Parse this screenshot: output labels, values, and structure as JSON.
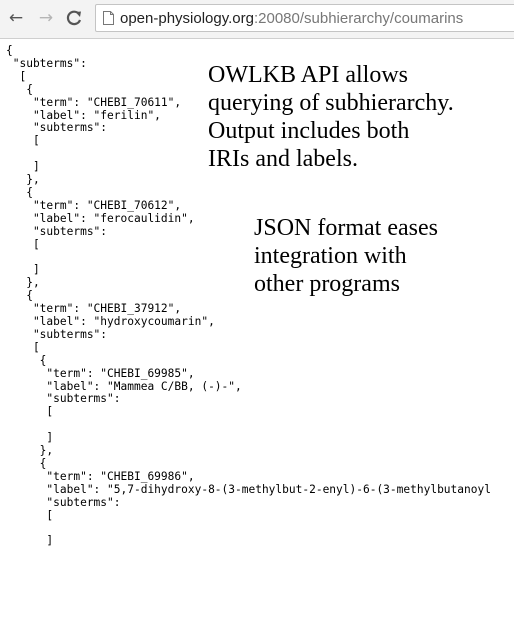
{
  "browser": {
    "back_icon": "←",
    "forward_icon": "→",
    "reload_icon": "C",
    "url_host": "open-physiology.org",
    "url_path": ":20080/subhierarchy/coumarins"
  },
  "json_lines": [
    "{",
    " \"subterms\":",
    "  [",
    "   {",
    "    \"term\": \"CHEBI_70611\",",
    "    \"label\": \"ferilin\",",
    "    \"subterms\":",
    "    [",
    "",
    "    ]",
    "   },",
    "   {",
    "    \"term\": \"CHEBI_70612\",",
    "    \"label\": \"ferocaulidin\",",
    "    \"subterms\":",
    "    [",
    "",
    "    ]",
    "   },",
    "   {",
    "    \"term\": \"CHEBI_37912\",",
    "    \"label\": \"hydroxycoumarin\",",
    "    \"subterms\":",
    "    [",
    "     {",
    "      \"term\": \"CHEBI_69985\",",
    "      \"label\": \"Mammea C/BB, (-)-\",",
    "      \"subterms\":",
    "      [",
    "",
    "      ]",
    "     },",
    "     {",
    "      \"term\": \"CHEBI_69986\",",
    "      \"label\": \"5,7-dihydroxy-8-(3-methylbut-2-enyl)-6-(3-methylbutanoyl",
    "      \"subterms\":",
    "      [",
    "",
    "      ]"
  ],
  "annotations": {
    "note1": "OWLKB API allows\nquerying of subhierarchy.\nOutput includes both\nIRIs and labels.",
    "note2": "JSON format eases\nintegration with\nother programs"
  }
}
